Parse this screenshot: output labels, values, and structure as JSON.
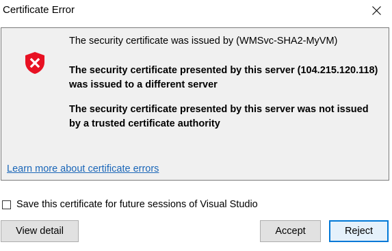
{
  "window": {
    "title": "Certificate Error",
    "close_icon": "close-icon"
  },
  "message": {
    "icon": "shield-error-icon",
    "issuer_line": "The security certificate was issued by (WMSvc-SHA2-MyVM)",
    "warning_mismatch": "The security certificate presented by this server (104.215.120.118) was issued to a different server",
    "warning_untrusted": "The security certificate presented by this server was not issued by a trusted certificate authority",
    "learn_more_link": "Learn more about certificate errors"
  },
  "save_option": {
    "label": "Save this certificate for future sessions of Visual Studio",
    "checked": false
  },
  "buttons": {
    "view_detail": "View detail",
    "accept": "Accept",
    "reject": "Reject"
  },
  "colors": {
    "shield_red": "#e81123",
    "link_blue": "#1a66b8",
    "focus_blue": "#0078d7",
    "panel_background": "#f0f0f0"
  }
}
